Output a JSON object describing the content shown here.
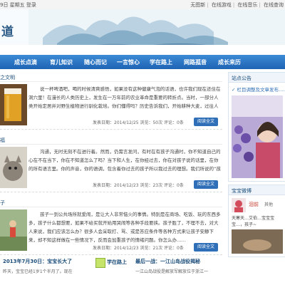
{
  "topbar": {
    "date": "9日 星期五 登录",
    "links": [
      "无图新",
      "在线游戏",
      "在线音乐",
      "在线查询"
    ]
  },
  "banner": {
    "logo_text": "道"
  },
  "nav": {
    "items": [
      "成长点滴",
      "育儿知识",
      "随心而记",
      "一言惊心",
      "学在路上",
      "网路孤音",
      "成长来历"
    ]
  },
  "posts": [
    {
      "title": "之文明",
      "body": "说一杯啤酒吧，喝的时候清爽感悟，如果没有这种健康气泡的话语，也许我们现在还住在洞穴里！在漫长的人类历史上，发生在一万年前的农业革命是重要的转折点。当时，一部分人类开始定居并对野生植物进行驯化栽培。你们懂得吗？历史告诉我们，开始耕种大麦，过往人类日常中的一个历史转变点，历史的起点……",
      "meta": "发表日期：2014/12/25  浏览：50次  评论：0条",
      "more": "阅读全文"
    },
    {
      "title": "福",
      "body": "沟通，无时无刻不在进行着。然而，仍需言发问，有时在有孩子沟通时，你不知道自己的心在不在当下，你在不知道怎么了吗？当下和人生，在你经过去，你在对孩子说的话里，在你的所有语言里。你的声音，你的语调，包含着你过去的孩子所以我过去的理想。我们所说的“孩子”，不仅是那个可能孩子，而是一个孩子，还有内在的孩子。我们不……",
      "meta": "发表日期：2014/12/23  浏览：23次  评论：0条",
      "more": "阅读全文"
    },
    {
      "title": "子",
      "body": "孩子一到公共场所就爱闹，是让大人非常恼火的事情。特别是在商场、吃饭、玩的东西多多，孩子什么都想要，如果不给买就开始用哭闹等各种手段要挟。孩子胜了，不理不去，对大人来说，我们应该怎么办？很多人会采取打、骂、或是答应条件等各种方式来让孩子安静下来，却不知这样做在一些情况下，反而会加重孩子的情绪问题。你怎么办……",
      "meta": "发表日期：2014/12/23  浏览：21次  评论：0条",
      "more": "阅读全文"
    }
  ],
  "sidebar": {
    "notice_title": "站点公告",
    "notice_text": "✓ 栏目调整及文章发布……",
    "weibo_title": "宝宝微博",
    "weibo_name": "泪前",
    "weibo_tag": "其他",
    "weibo_text": "天寒天…艾伯…宝宝宝宝…，孩子~"
  },
  "bottom": [
    {
      "title": "2013年7月30日：宝宝长大了",
      "sub": "昨天，宝宝已经1岁1个半月了。现在"
    },
    {
      "title": "学在路上",
      "sub": ""
    },
    {
      "title": "最后一战：一江山岛战役揭秘",
      "sub": "一江山岛战役是解放军解放位于浙江一"
    }
  ]
}
